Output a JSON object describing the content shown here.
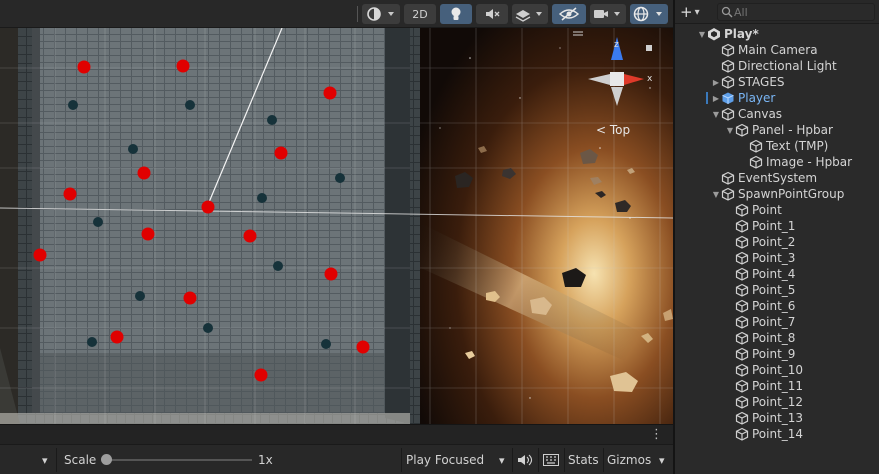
{
  "scene_toolbar": {
    "mode_2d_label": "2D",
    "dropdown_arrow": "▾"
  },
  "gizmo": {
    "axis_z": "z",
    "axis_x": "x",
    "view_label": "< Top"
  },
  "game_toolbar": {
    "display_arrow": "▾",
    "scale_label": "Scale",
    "scale_value": "1x",
    "play_mode_label": "Play Focused",
    "play_mode_arrow": "▾",
    "stats_label": "Stats",
    "gizmos_label": "Gizmos",
    "gizmos_arrow": "▾",
    "more_icon": "⋮"
  },
  "hierarchy": {
    "add_label": "+",
    "add_arrow": "▾",
    "search_placeholder": "All",
    "items": [
      {
        "label": "Play*",
        "depth": 0,
        "expanded": true,
        "type": "scene",
        "selected": false
      },
      {
        "label": "Main Camera",
        "depth": 1,
        "type": "object"
      },
      {
        "label": "Directional Light",
        "depth": 1,
        "type": "object"
      },
      {
        "label": "STAGES",
        "depth": 1,
        "type": "object",
        "collapsed": true
      },
      {
        "label": "Player",
        "depth": 1,
        "type": "prefab",
        "collapsed": true
      },
      {
        "label": "Canvas",
        "depth": 1,
        "type": "object",
        "expanded": true
      },
      {
        "label": "Panel - Hpbar",
        "depth": 2,
        "type": "object",
        "expanded": true
      },
      {
        "label": "Text (TMP)",
        "depth": 3,
        "type": "object"
      },
      {
        "label": "Image - Hpbar",
        "depth": 3,
        "type": "object"
      },
      {
        "label": "EventSystem",
        "depth": 1,
        "type": "object"
      },
      {
        "label": "SpawnPointGroup",
        "depth": 1,
        "type": "object",
        "expanded": true
      },
      {
        "label": "Point",
        "depth": 2,
        "type": "object"
      },
      {
        "label": "Point_1",
        "depth": 2,
        "type": "object"
      },
      {
        "label": "Point_2",
        "depth": 2,
        "type": "object"
      },
      {
        "label": "Point_3",
        "depth": 2,
        "type": "object"
      },
      {
        "label": "Point_4",
        "depth": 2,
        "type": "object"
      },
      {
        "label": "Point_5",
        "depth": 2,
        "type": "object"
      },
      {
        "label": "Point_6",
        "depth": 2,
        "type": "object"
      },
      {
        "label": "Point_7",
        "depth": 2,
        "type": "object"
      },
      {
        "label": "Point_8",
        "depth": 2,
        "type": "object"
      },
      {
        "label": "Point_9",
        "depth": 2,
        "type": "object"
      },
      {
        "label": "Point_10",
        "depth": 2,
        "type": "object"
      },
      {
        "label": "Point_11",
        "depth": 2,
        "type": "object"
      },
      {
        "label": "Point_12",
        "depth": 2,
        "type": "object"
      },
      {
        "label": "Point_13",
        "depth": 2,
        "type": "object"
      },
      {
        "label": "Point_14",
        "depth": 2,
        "type": "object"
      }
    ]
  },
  "colors": {
    "spawn_point": "#e00000",
    "selection_blue": "#3a79bb",
    "prefab_blue": "#7ab6f5",
    "panel_bg": "#282828"
  }
}
